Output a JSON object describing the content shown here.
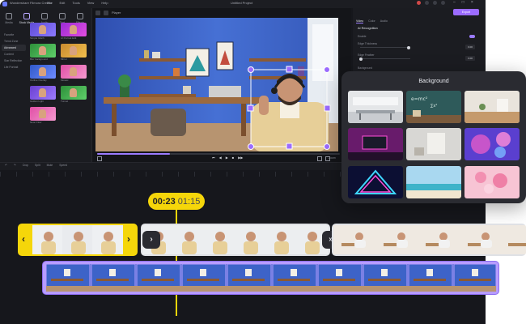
{
  "app": {
    "name": "Wondershare Filmora Creator",
    "menu": [
      "File",
      "Edit",
      "Tools",
      "View",
      "Help"
    ],
    "project_title": "Untitled Project"
  },
  "left_panel": {
    "tabs": [
      {
        "label": "Media",
        "icon": "media-icon"
      },
      {
        "label": "Stock Media",
        "icon": "stock-icon"
      },
      {
        "label": "Audio",
        "icon": "audio-icon"
      },
      {
        "label": "Text",
        "icon": "text-icon"
      },
      {
        "label": "Effects",
        "icon": "effects-icon"
      }
    ],
    "categories": [
      "Favorite",
      "Trend Zone",
      "Advanced",
      "Content",
      "Star Reflection",
      "Life Portrait"
    ],
    "active_category": "Advanced",
    "effects": [
      {
        "name": "Simple Glitch"
      },
      {
        "name": "AI Portrait Edit"
      },
      {
        "name": "Blur background"
      },
      {
        "name": "Mirror"
      },
      {
        "name": "Outline Overlay"
      },
      {
        "name": "Mosaic"
      },
      {
        "name": "Golden Light"
      },
      {
        "name": "Tunnel"
      },
      {
        "name": "Neon Flow"
      }
    ]
  },
  "preview": {
    "player_label": "Player",
    "controls": [
      "⏮",
      "◀",
      "▶",
      "■",
      "▶▶"
    ],
    "ratio": "Zoom"
  },
  "properties": {
    "export_label": "Export",
    "tabs": [
      "Video",
      "Color",
      "Audio"
    ],
    "section": "AI Recognition",
    "rows": [
      "Enable",
      "Edge Thickness",
      "Edge Feather",
      "Background"
    ],
    "values": [
      "0.00",
      "0.00"
    ]
  },
  "toolbar": {
    "tools": [
      "↶",
      "↷",
      "Crop",
      "Split",
      "Mute",
      "Speed"
    ]
  },
  "background_panel": {
    "title": "Background",
    "items": [
      {
        "name": "office-room"
      },
      {
        "name": "chalkboard"
      },
      {
        "name": "white-desk"
      },
      {
        "name": "neon-room"
      },
      {
        "name": "white-studio"
      },
      {
        "name": "pink-space"
      },
      {
        "name": "neon-triangle"
      },
      {
        "name": "beach"
      },
      {
        "name": "pink-balloons"
      }
    ]
  },
  "timeline": {
    "current_time": "00:23",
    "total_time": "01:15"
  },
  "colors": {
    "accent": "#9b7bff",
    "playhead": "#f5d60a",
    "background_track": "#b79cff"
  }
}
